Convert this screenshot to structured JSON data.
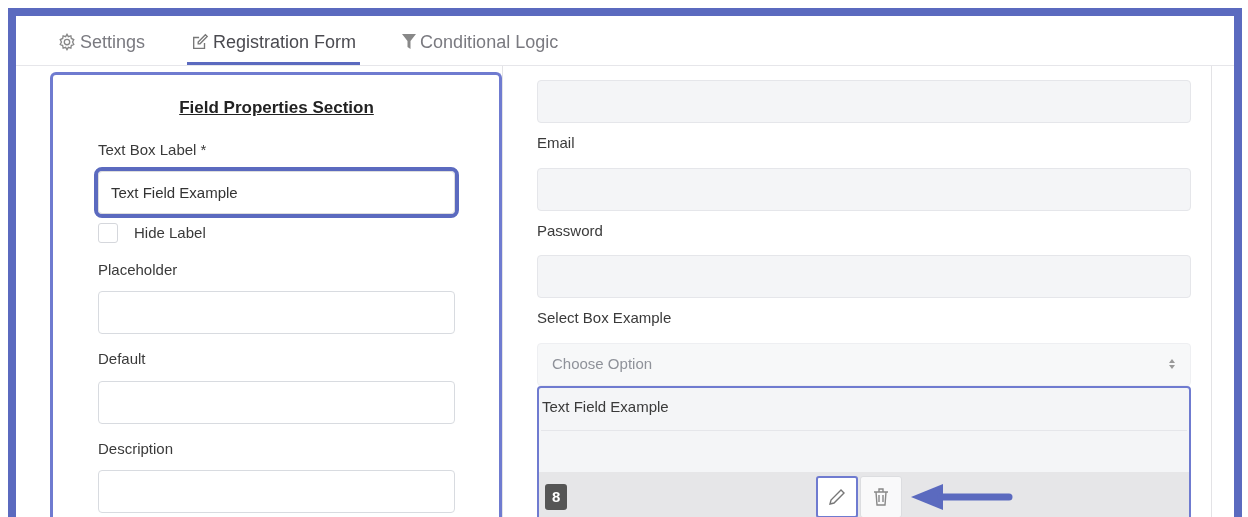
{
  "tabs": [
    {
      "label": "Settings",
      "kind": "settings",
      "selected": false
    },
    {
      "label": "Registration Form",
      "kind": "form",
      "selected": true
    },
    {
      "label": "Conditional Logic",
      "kind": "logic",
      "selected": false
    }
  ],
  "properties_panel": {
    "title": "Field Properties Section",
    "fields": [
      {
        "kind": "input",
        "label": "Text Box Label *",
        "value": "Text Field Example",
        "highlighted": true
      },
      {
        "kind": "checkbox",
        "label": "Hide Label",
        "checked": false
      },
      {
        "kind": "input",
        "label": "Placeholder",
        "highlighted": false
      },
      {
        "kind": "input",
        "label": "Default",
        "highlighted": false
      },
      {
        "kind": "input",
        "label": "Description",
        "highlighted": false
      }
    ]
  },
  "form_preview": {
    "items": [
      {
        "kind": "input"
      },
      {
        "kind": "label",
        "text": "Email"
      },
      {
        "kind": "input"
      },
      {
        "kind": "label",
        "text": "Password"
      },
      {
        "kind": "input"
      },
      {
        "kind": "label",
        "text": "Select Box Example"
      },
      {
        "kind": "select",
        "placeholder": "Choose Option"
      },
      {
        "kind": "active_field",
        "label": "Text Field Example",
        "number": "8"
      }
    ]
  }
}
